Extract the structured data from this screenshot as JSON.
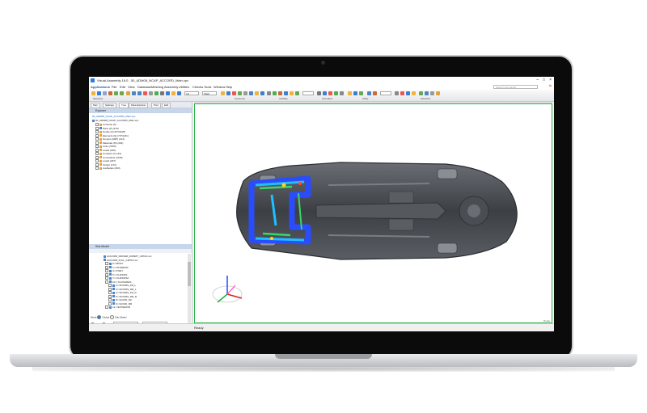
{
  "window": {
    "title": "Visual-Assembly 16.0 - 50_ADM08_NCAP_ACCORD_Main.vpc"
  },
  "menu": {
    "items": [
      "Applications",
      "File",
      "Edit",
      "View",
      "Database",
      "Meshing",
      "Assembly",
      "Utilities",
      "Checks",
      "Tools",
      "Window",
      "Help"
    ],
    "search_placeholder": "Search commands"
  },
  "ribbon": {
    "field_1": "Inc",
    "field_2": "Shell",
    "groups": [
      "Selection",
      "Geometry",
      "Visibility",
      "Animation",
      "Utility",
      "Selection"
    ]
  },
  "left_panel": {
    "tabs": [
      "Part",
      "Settings",
      "Tree",
      "Files Explorer",
      "Pref",
      "Edit"
    ],
    "explorer_label": "Explorer",
    "root": "50_ADM08_NCAP_ACCORD_Main.vpc",
    "tree": [
      "Contents (0)",
      "Parts (P) (276)",
      "Nodes (N) (8731025)",
      "Elements (E) (7374241)",
      "Groups (GRP) (214)",
      "Materials (M) (202)",
      "Links (7960)",
      "Loads (200)",
      "Contacts (C) (33)",
      "Constraints (3795)",
      "Loads (297)",
      "Output (173)",
      "Auxiliaries (203)"
    ]
  },
  "sub_model": {
    "label": "Sub-Model",
    "tree": [
      "ACCORD_DRIVER_DUMMY_CRTAC.inc",
      "ACCORD_FULL_CRTAC.inc",
      "0<<BODY",
      "1<<INTERIOR",
      "4<<FNET",
      "5<<CHASSIS",
      "7<<CHASSIS2",
      "10<<CLOSURES",
      "2<<DOORS_FR_L",
      "3<<DOORS_RR_L",
      "4<<DOORS_FR_R",
      "6<<DOORS_RR_R",
      "8<<HOOD_FR",
      "9<<HOOD_RR",
      "11<<EXTERIOR"
    ],
    "scope_label": "Mode",
    "scope_options": [
      "Global",
      "Sub-Model"
    ],
    "filter_label": "Filter",
    "field_label": "Find",
    "combo_value": "Entity Name"
  },
  "status": {
    "text": "Ready",
    "view_label": "Persp"
  },
  "colors": {
    "viewport_border": "#2db54a",
    "accent": "#1a5fb4"
  }
}
